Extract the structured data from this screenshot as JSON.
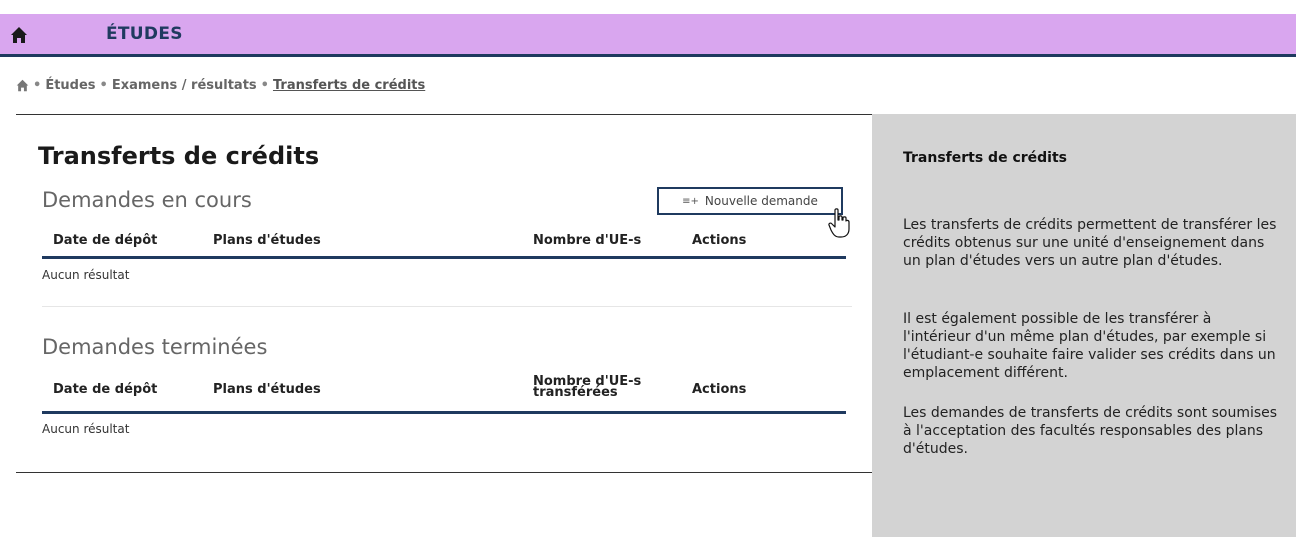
{
  "header": {
    "title": "ÉTUDES",
    "icon": "home-icon",
    "bg_color": "#d9a6ef",
    "border_color": "#1f3a5f"
  },
  "breadcrumb": {
    "separator": "•",
    "items": [
      "Études",
      "Examens / résultats"
    ],
    "current": "Transferts de crédits"
  },
  "main": {
    "title": "Transferts de crédits",
    "new_request_button": "Nouvelle demande",
    "pending": {
      "title": "Demandes en cours",
      "columns": [
        "Date de dépôt",
        "Plans d'études",
        "Nombre d'UE-s",
        "Actions"
      ],
      "empty_text": "Aucun résultat"
    },
    "completed": {
      "title": "Demandes terminées",
      "columns": [
        "Date de dépôt",
        "Plans d'études",
        "Nombre d'UE-s transférées",
        "Actions"
      ],
      "empty_text": "Aucun résultat"
    }
  },
  "aside": {
    "title": "Transferts de crédits",
    "paragraphs": [
      "Les transferts de crédits permettent de transférer les crédits obtenus sur une unité d'enseignement dans un plan d'études vers un autre plan d'études.",
      "Il est également possible de les transférer à l'intérieur d'un même plan d'études, par exemple si l'étudiant-e souhaite faire valider ses crédits dans un emplacement différent.",
      "Les demandes de transferts de crédits sont soumises à l'acceptation des facultés responsables des plans d'études."
    ]
  }
}
